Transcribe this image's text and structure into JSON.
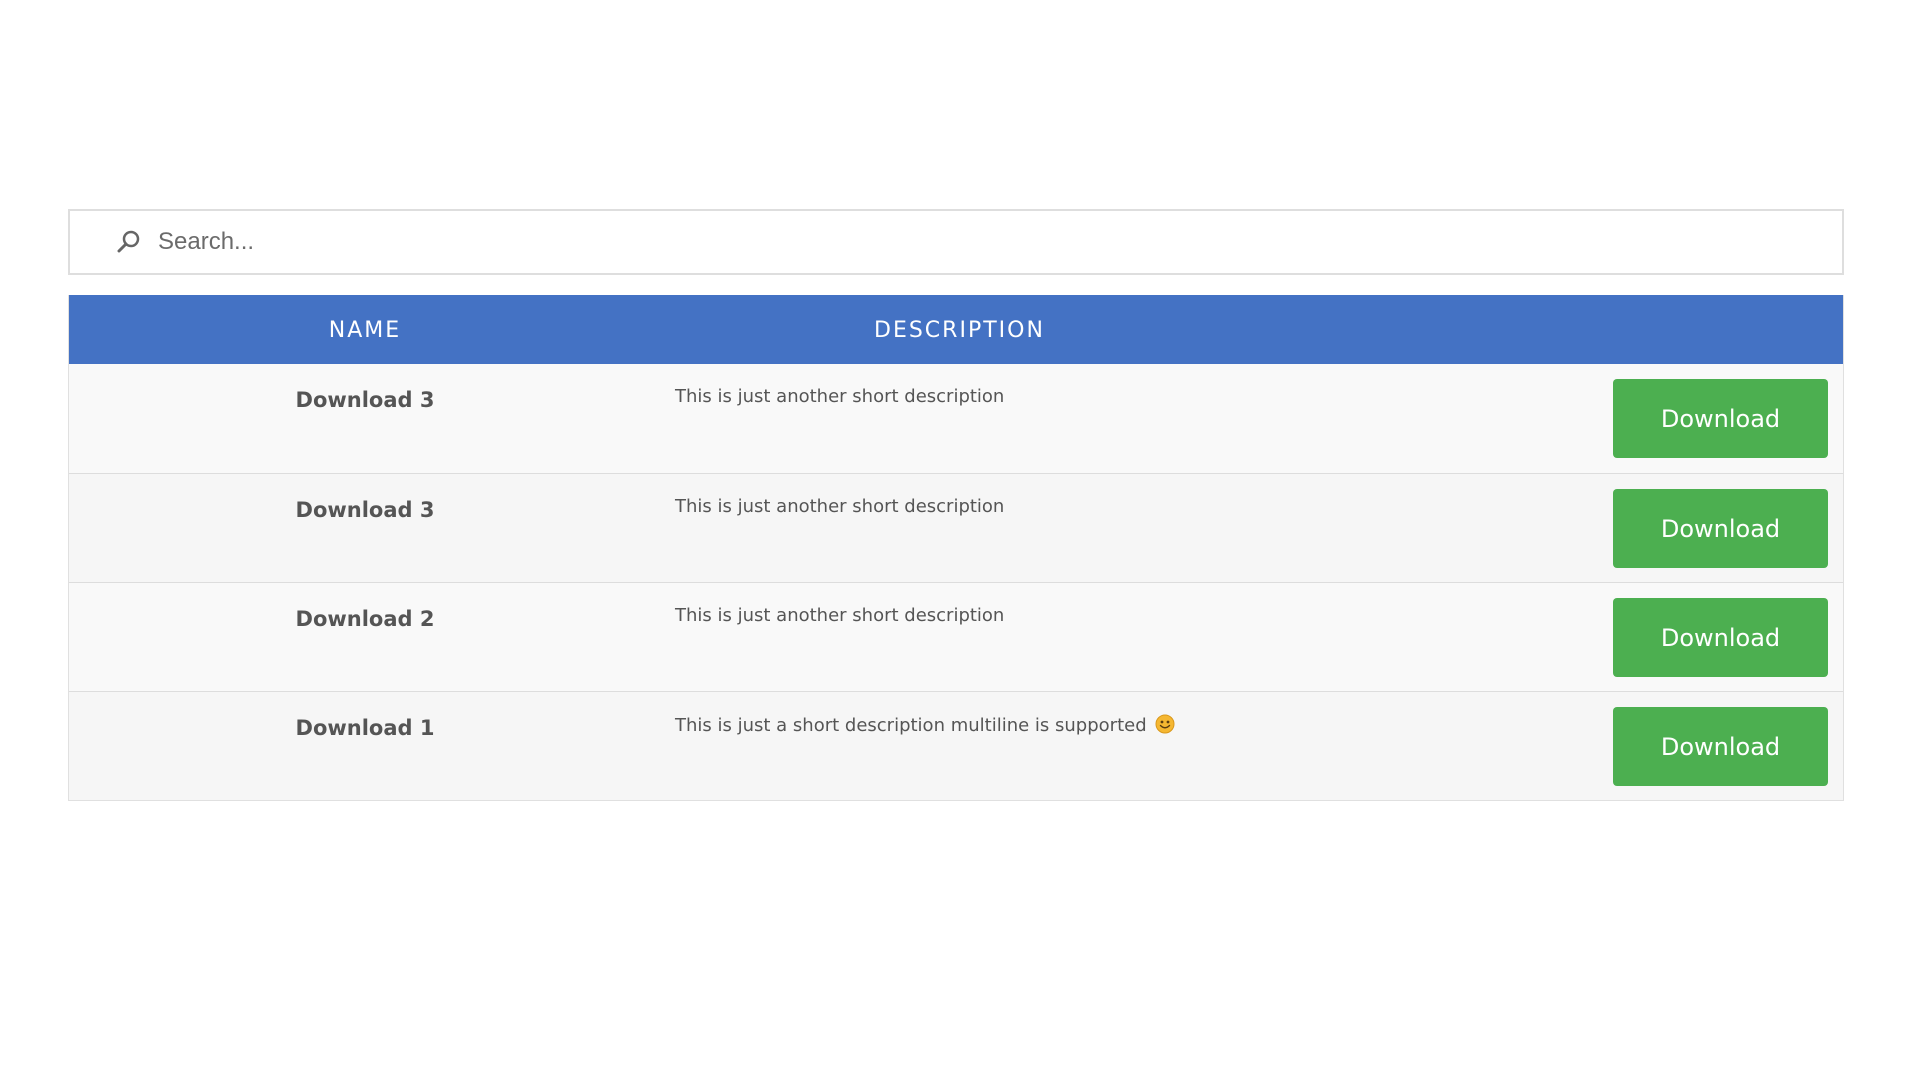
{
  "search": {
    "placeholder": "Search...",
    "icon": "search-icon"
  },
  "table": {
    "headers": {
      "name": "NAME",
      "description": "DESCRIPTION"
    },
    "rows": [
      {
        "name": "Download 3",
        "description": "This is just another short description",
        "button": "Download"
      },
      {
        "name": "Download 3",
        "description": "This is just another short description",
        "button": "Download"
      },
      {
        "name": "Download 2",
        "description": "This is just another short description",
        "button": "Download"
      },
      {
        "name": "Download 1",
        "description": "This is just a short description multiline is supported",
        "button": "Download",
        "emoji": "smiley-icon"
      }
    ]
  },
  "colors": {
    "header_bg": "#4472c4",
    "button_bg": "#4caf50",
    "button_text": "#ffffff"
  }
}
